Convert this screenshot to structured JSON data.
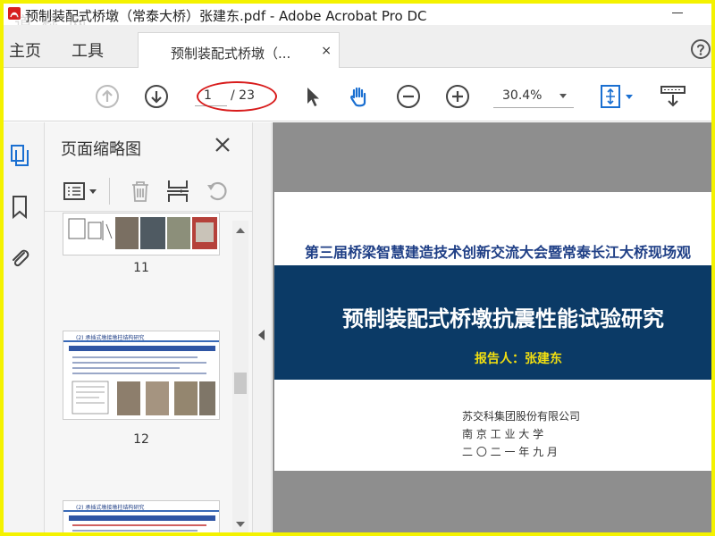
{
  "window": {
    "title": "预制装配式桥墩（常泰大桥）张建东.pdf - Adobe Acrobat Pro DC",
    "watermark": "道 标 网"
  },
  "nav": {
    "home": "主页",
    "tools": "工具"
  },
  "tab": {
    "label": "预制装配式桥墩（...",
    "close": "×"
  },
  "toolbar": {
    "page_current": "1",
    "page_total": "/ 23",
    "zoom": "30.4%"
  },
  "thumbnails_panel": {
    "title": "页面缩略图",
    "pages": [
      {
        "number": "11"
      },
      {
        "number": "12",
        "heading": "(2) 承插式墩接墩柱结构研究"
      },
      {
        "heading": "(2) 承插式墩接墩柱结构研究"
      }
    ]
  },
  "slide": {
    "conference": "第三届桥梁智慧建造技术创新交流大会暨常泰长江大桥现场观",
    "title": "预制装配式桥墩抗震性能试验研究",
    "presenter": "报告人：张建东",
    "organization": "苏交科集团股份有限公司",
    "university": "南  京  工  业  大  学",
    "date": "二 〇 二 一 年 九 月"
  },
  "colors": {
    "band": "#0b3a66",
    "conference_text": "#1f3f86",
    "presenter_text": "#f2df10",
    "accent_icon": "#1a6fd1",
    "annotation_ellipse": "#d81c1c",
    "frame_highlight": "#f4f200"
  }
}
